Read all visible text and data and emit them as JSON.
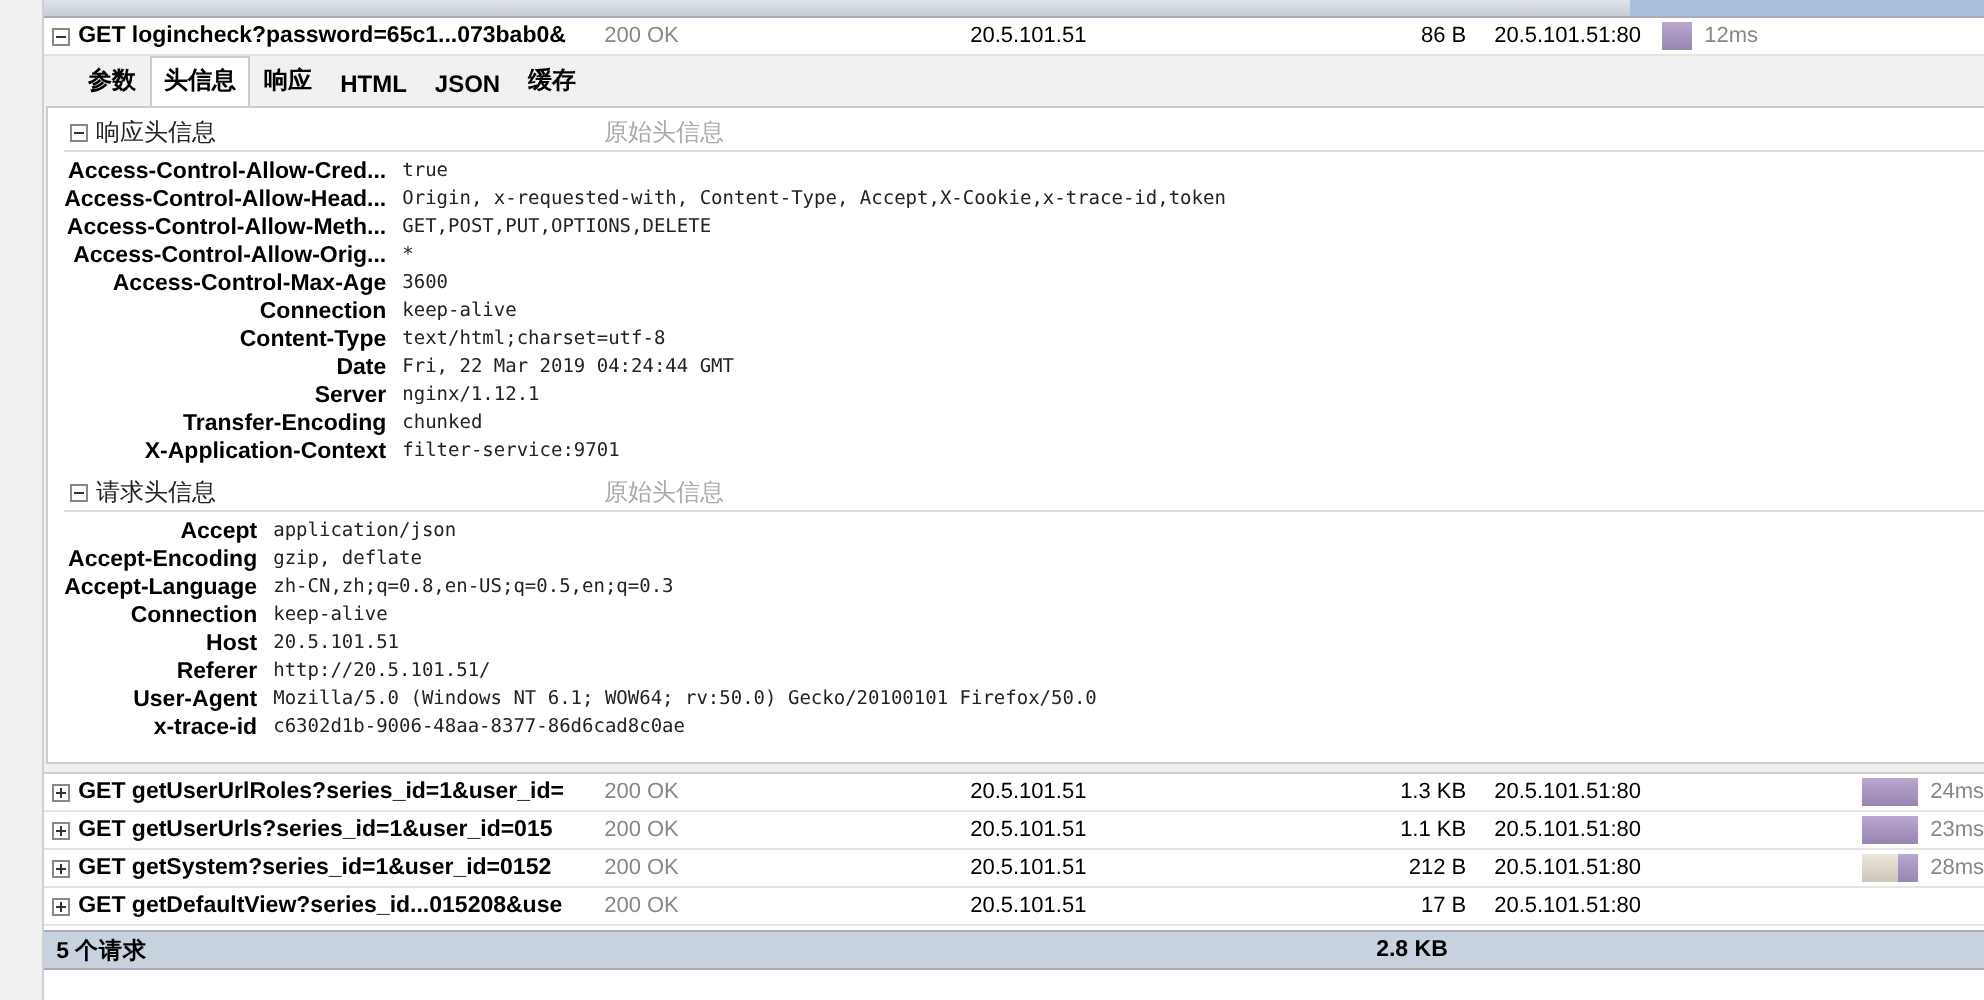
{
  "requests": [
    {
      "method": "GET",
      "url": "logincheck?password=65c1...073bab0&",
      "status": "200 OK",
      "domain": "20.5.101.51",
      "size": "86 B",
      "remote_ip": "20.5.101.51:80",
      "time": "12ms",
      "expanded": true
    },
    {
      "method": "GET",
      "url": "getUserUrlRoles?series_id=1&user_id=",
      "status": "200 OK",
      "domain": "20.5.101.51",
      "size": "1.3 KB",
      "remote_ip": "20.5.101.51:80",
      "time": "24ms",
      "expanded": false
    },
    {
      "method": "GET",
      "url": "getUserUrls?series_id=1&user_id=015",
      "status": "200 OK",
      "domain": "20.5.101.51",
      "size": "1.1 KB",
      "remote_ip": "20.5.101.51:80",
      "time": "23ms",
      "expanded": false
    },
    {
      "method": "GET",
      "url": "getSystem?series_id=1&user_id=0152",
      "status": "200 OK",
      "domain": "20.5.101.51",
      "size": "212 B",
      "remote_ip": "20.5.101.51:80",
      "time": "28ms",
      "expanded": false
    },
    {
      "method": "GET",
      "url": "getDefaultView?series_id...015208&use",
      "status": "200 OK",
      "domain": "20.5.101.51",
      "size": "17 B",
      "remote_ip": "20.5.101.51:80",
      "expanded": false
    }
  ],
  "detail_tabs": [
    {
      "label": "参数",
      "selected": false
    },
    {
      "label": "头信息",
      "selected": true
    },
    {
      "label": "响应",
      "selected": false
    },
    {
      "label": "HTML",
      "selected": false
    },
    {
      "label": "JSON",
      "selected": false
    },
    {
      "label": "缓存",
      "selected": false
    }
  ],
  "sections": [
    {
      "title": "响应头信息",
      "raw_link": "原始头信息",
      "expanded": true,
      "headers": [
        {
          "name": "Access-Control-Allow-Cred...",
          "value": "true"
        },
        {
          "name": "Access-Control-Allow-Head...",
          "value": "Origin, x-requested-with, Content-Type, Accept,X-Cookie,x-trace-id,token"
        },
        {
          "name": "Access-Control-Allow-Meth...",
          "value": "GET,POST,PUT,OPTIONS,DELETE"
        },
        {
          "name": "Access-Control-Allow-Orig...",
          "value": "*"
        },
        {
          "name": "Access-Control-Max-Age",
          "value": "3600"
        },
        {
          "name": "Connection",
          "value": "keep-alive"
        },
        {
          "name": "Content-Type",
          "value": "text/html;charset=utf-8"
        },
        {
          "name": "Date",
          "value": "Fri, 22 Mar 2019 04:24:44 GMT"
        },
        {
          "name": "Server",
          "value": "nginx/1.12.1"
        },
        {
          "name": "Transfer-Encoding",
          "value": "chunked"
        },
        {
          "name": "X-Application-Context",
          "value": "filter-service:9701"
        }
      ]
    },
    {
      "title": "请求头信息",
      "raw_link": "原始头信息",
      "expanded": true,
      "headers": [
        {
          "name": "Accept",
          "value": "application/json"
        },
        {
          "name": "Accept-Encoding",
          "value": "gzip, deflate"
        },
        {
          "name": "Accept-Language",
          "value": "zh-CN,zh;q=0.8,en-US;q=0.5,en;q=0.3"
        },
        {
          "name": "Connection",
          "value": "keep-alive"
        },
        {
          "name": "Host",
          "value": "20.5.101.51"
        },
        {
          "name": "Referer",
          "value": "http://20.5.101.51/"
        },
        {
          "name": "User-Agent",
          "value": "Mozilla/5.0 (Windows NT 6.1; WOW64; rv:50.0) Gecko/20100101 Firefox/50.0"
        },
        {
          "name": "x-trace-id",
          "value": "c6302d1b-9006-48aa-8377-86d6cad8c0ae"
        }
      ]
    }
  ],
  "summary": {
    "count": "5 个请求",
    "total_size": "2.8 KB"
  }
}
